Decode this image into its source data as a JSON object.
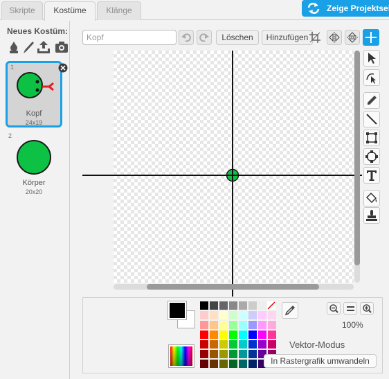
{
  "tabs": [
    {
      "label": "Skripte",
      "active": false
    },
    {
      "label": "Kostüme",
      "active": true
    },
    {
      "label": "Klänge",
      "active": false
    }
  ],
  "project_button": {
    "label": "Zeige Projektseite",
    "icon": "swap-arrows-icon",
    "color": "#1aa0e6"
  },
  "left_panel": {
    "new_costume_label": "Neues Kostüm:",
    "tools": [
      "sprite-library-icon",
      "paint-brush-icon",
      "upload-icon",
      "camera-icon"
    ]
  },
  "costumes": [
    {
      "number": "1",
      "name": "Kopf",
      "size": "24x19",
      "selected": true
    },
    {
      "number": "2",
      "name": "Körper",
      "size": "20x20",
      "selected": false
    }
  ],
  "editor": {
    "name_placeholder": "Kopf",
    "clear_label": "Löschen",
    "add_label": "Hinzufügen",
    "tools_top": [
      "undo-icon",
      "redo-icon",
      "crop-icon",
      "flip-horizontal-icon",
      "flip-vertical-icon",
      "set-center-icon"
    ]
  },
  "right_tools": [
    "select-icon",
    "reshape-icon",
    "pencil-icon",
    "line-icon",
    "rectangle-icon",
    "ellipse-icon",
    "text-icon",
    "fill-icon",
    "stamp-icon"
  ],
  "bottom": {
    "zoom": "100%",
    "mode_label": "Vektor-Modus",
    "convert_label": "In Rastergrafik umwandeln",
    "fg_color": "#000000",
    "bg_color": "#ffffff"
  },
  "accent_color": "#1aa0e6",
  "costume_color": "#0dc144"
}
